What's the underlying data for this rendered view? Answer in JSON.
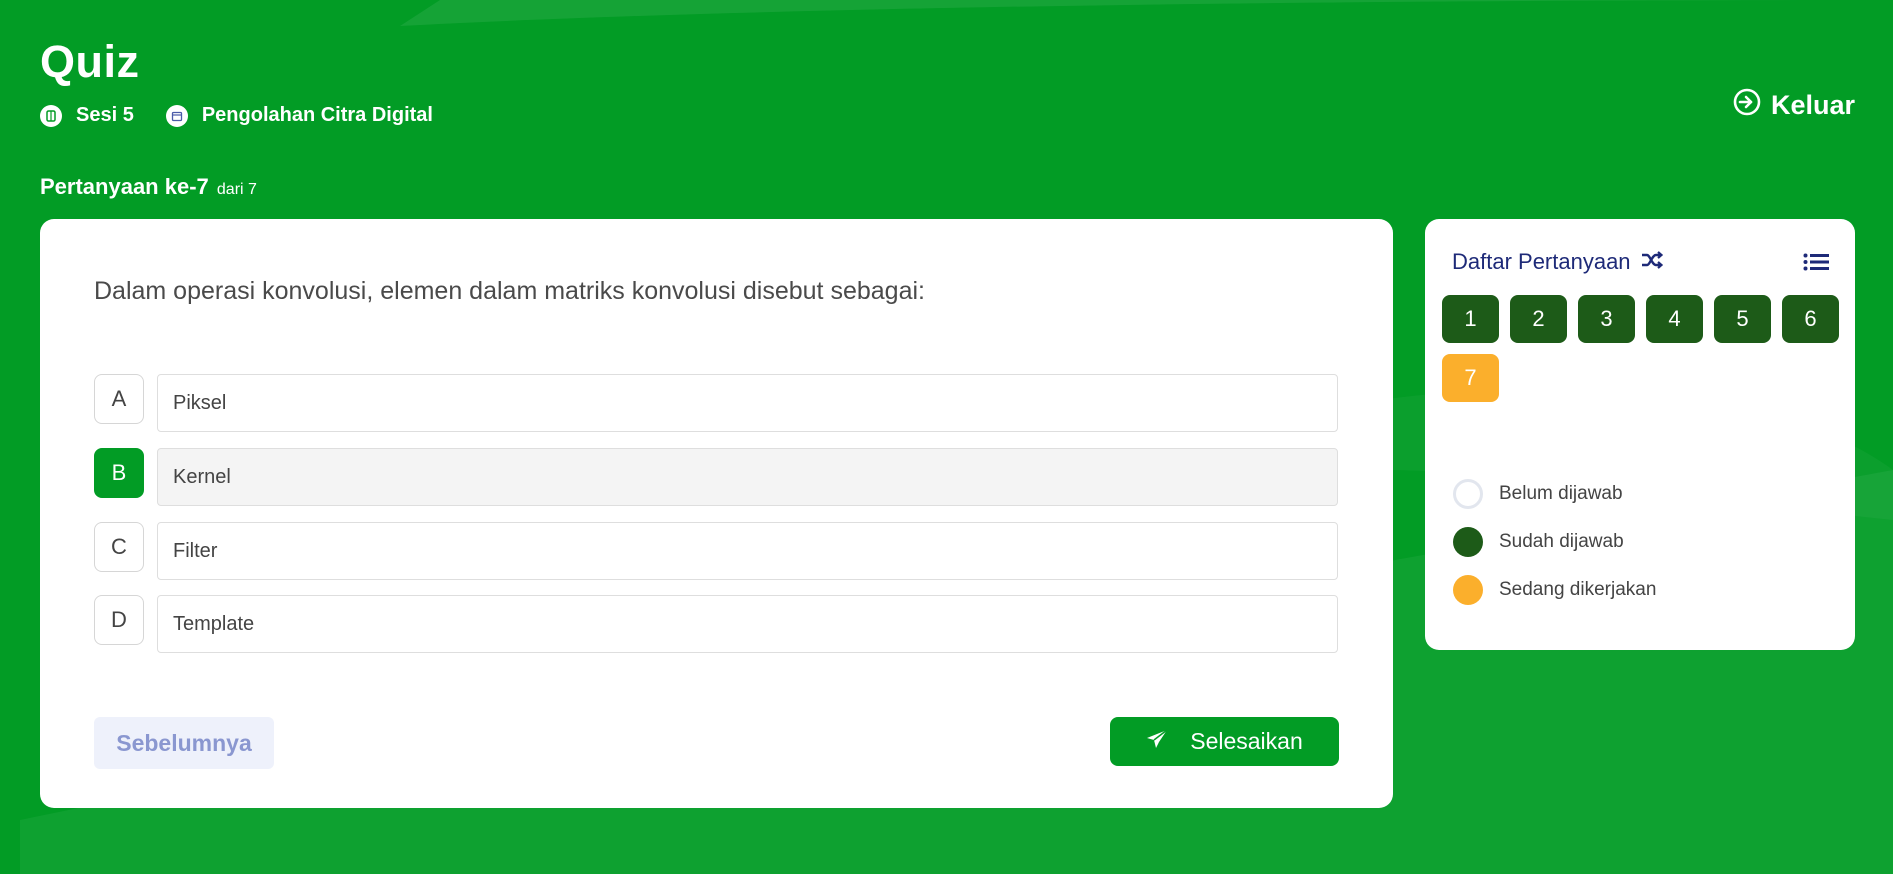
{
  "header": {
    "title": "Quiz",
    "session": "Sesi 5",
    "course": "Pengolahan Citra Digital",
    "logout_label": "Keluar"
  },
  "question": {
    "label": "Pertanyaan ke-7",
    "of_label": "dari 7",
    "text": "Dalam operasi konvolusi, elemen dalam matriks konvolusi disebut sebagai:",
    "selected": "B",
    "options": [
      {
        "letter": "A",
        "text": "Piksel"
      },
      {
        "letter": "B",
        "text": "Kernel"
      },
      {
        "letter": "C",
        "text": "Filter"
      },
      {
        "letter": "D",
        "text": "Template"
      }
    ]
  },
  "buttons": {
    "prev_label": "Sebelumnya",
    "finish_label": "Selesaikan"
  },
  "sidebar": {
    "title": "Daftar Pertanyaan",
    "numbers": [
      "1",
      "2",
      "3",
      "4",
      "5",
      "6",
      "7"
    ],
    "current": "7",
    "legend": {
      "unanswered": "Belum dijawab",
      "answered": "Sudah dijawab",
      "in_progress": "Sedang dikerjakan"
    }
  },
  "colors": {
    "background": "#029c25",
    "answered": "#1d5b18",
    "current": "#fbaf2c",
    "sidebar_title": "#1e2a78"
  }
}
